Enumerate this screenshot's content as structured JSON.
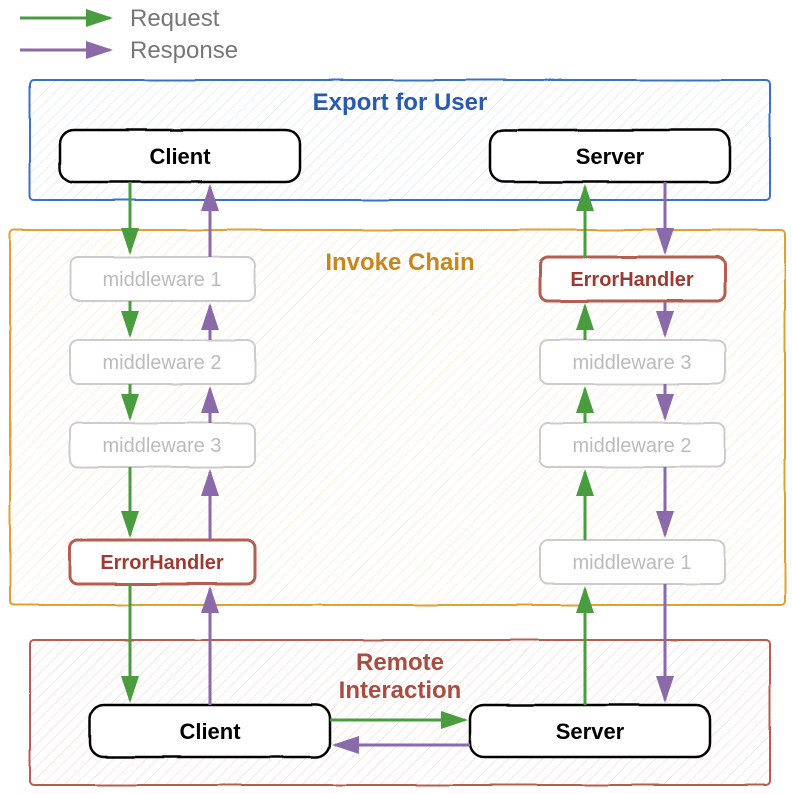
{
  "legend": {
    "request": "Request",
    "response": "Response"
  },
  "sections": {
    "export": "Export for User",
    "invoke": "Invoke Chain",
    "remote": "Remote\nInteraction"
  },
  "boxes": {
    "client_top": "Client",
    "server_top": "Server",
    "client_bottom": "Client",
    "server_bottom": "Server",
    "error_handler": "ErrorHandler"
  },
  "middleware": {
    "m1": "middleware 1",
    "m2": "middleware 2",
    "m3": "middleware 3"
  },
  "colors": {
    "request": "#4a9d3f",
    "response": "#8a6aa8",
    "export_border": "#3b6fc9",
    "export_fill": "#e8f0fb",
    "invoke_border": "#e0a030",
    "invoke_fill": "#fdf4e3",
    "remote_border": "#b85c4f",
    "remote_fill": "#f6e9e6",
    "gray": "#ccc",
    "error_border": "#b85c4f"
  }
}
